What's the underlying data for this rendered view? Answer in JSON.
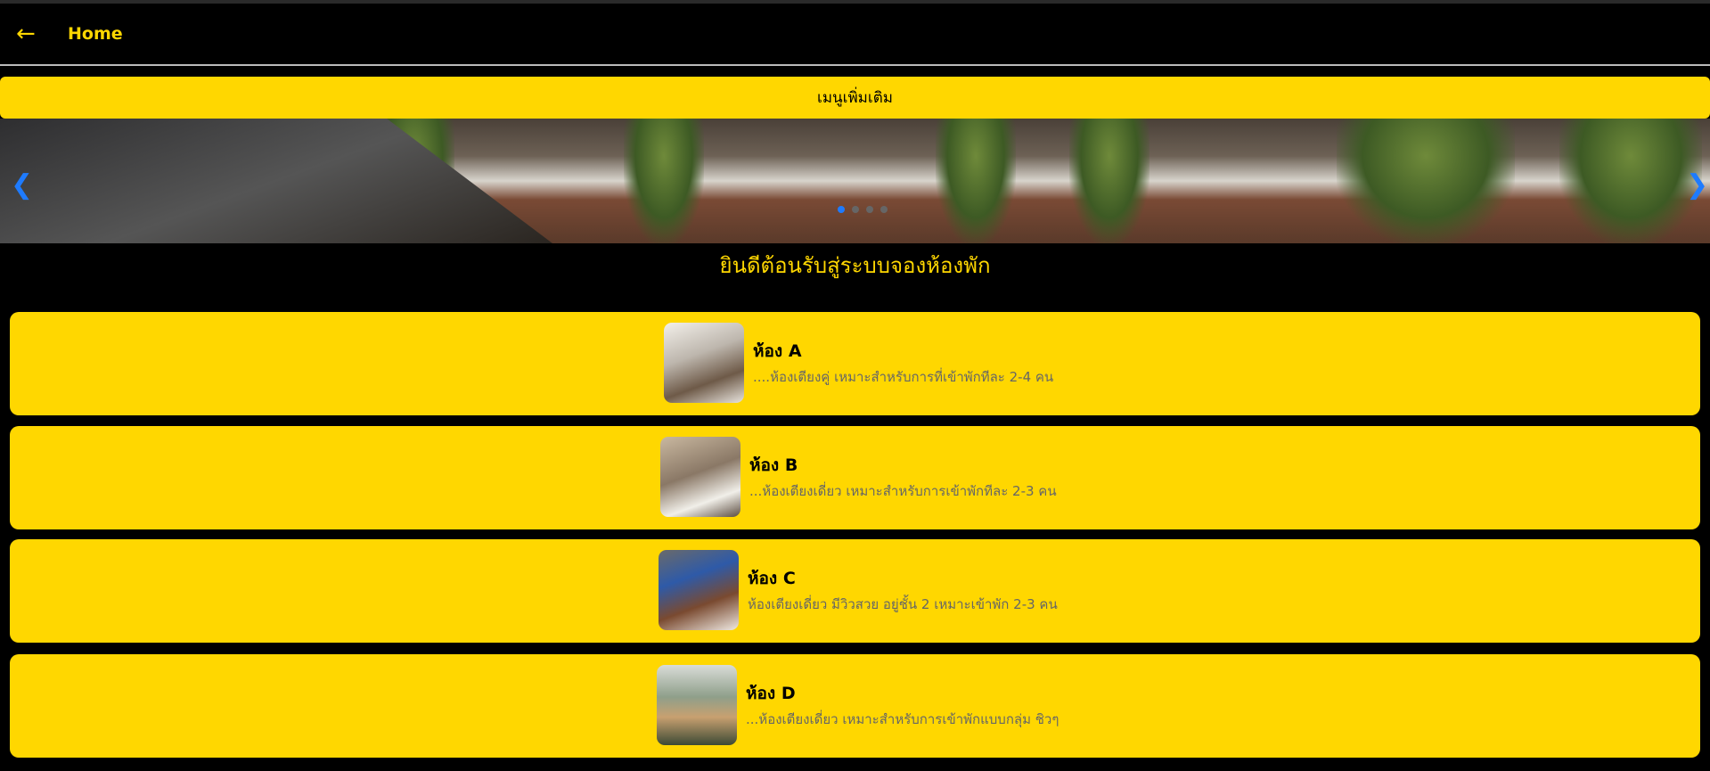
{
  "header": {
    "back_icon": "arrow-left",
    "title": "Home"
  },
  "menu": {
    "label": "เมนูเพิ่มเติม"
  },
  "carousel": {
    "prev_icon": "chevron-left",
    "next_icon": "chevron-right",
    "slide_count": 4,
    "active_index": 0
  },
  "welcome": "ยินดีต้อนรับสู่ระบบจองห้องพัก",
  "rooms": [
    {
      "name": "ห้อง A",
      "desc": "....ห้องเตียงคู่ เหมาะสำหรับการที่เข้าพักทีละ 2-4 คน"
    },
    {
      "name": "ห้อง B",
      "desc": "...ห้องเตียงเดี่ยว เหมาะสำหรับการเข้าพักทีละ 2-3 คน"
    },
    {
      "name": "ห้อง C",
      "desc": "ห้องเตียงเดี่ยว มีวิวสวย อยู่ชั้น 2 เหมาะเข้าพัก 2-3 คน"
    },
    {
      "name": "ห้อง D",
      "desc": "...ห้องเตียงเดี่ยว เหมาะสำหรับการเข้าพักแบบกลุ่ม ชิวๆ"
    }
  ],
  "colors": {
    "accent": "#FFD700",
    "background": "#000000",
    "carousel_control": "#1e7bff"
  }
}
